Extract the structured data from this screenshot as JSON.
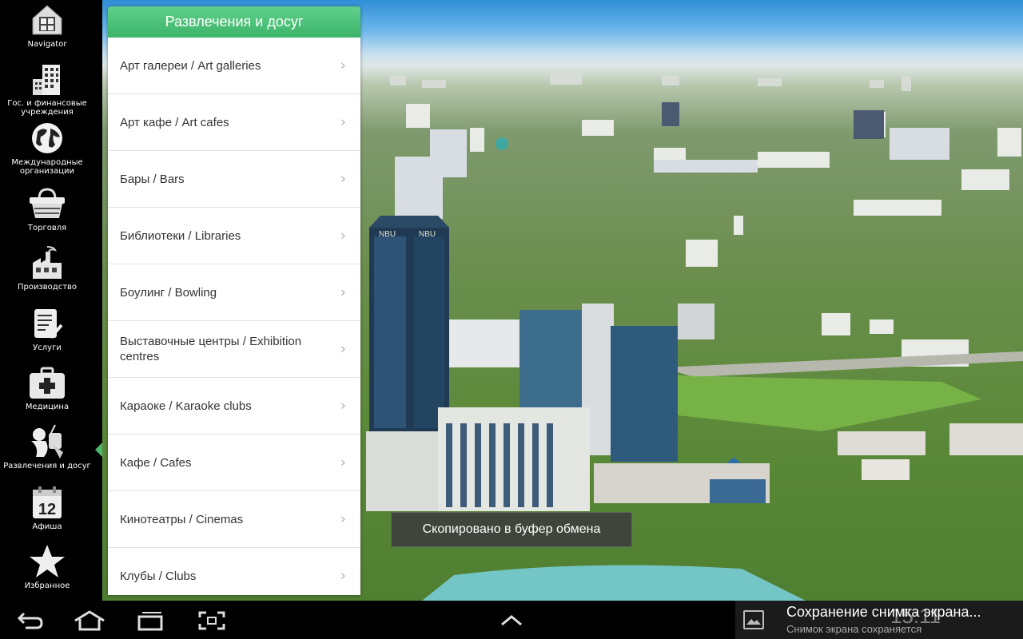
{
  "sidebar": {
    "items": [
      {
        "label": "Navigator",
        "icon": "home-grid-icon"
      },
      {
        "label": "Гос. и финансовые учреждения",
        "icon": "office-building-icon"
      },
      {
        "label": "Международные организации",
        "icon": "globe-icon"
      },
      {
        "label": "Торговля",
        "icon": "shopping-basket-icon"
      },
      {
        "label": "Производство",
        "icon": "factory-icon"
      },
      {
        "label": "Услуги",
        "icon": "checklist-icon"
      },
      {
        "label": "Медицина",
        "icon": "medical-kit-icon"
      },
      {
        "label": "Развлечения и досуг",
        "icon": "entertainment-icon"
      },
      {
        "label": "Афиша",
        "icon": "calendar-icon",
        "calendar_day": "12"
      },
      {
        "label": "Избранное",
        "icon": "star-icon"
      }
    ],
    "active_index": 7
  },
  "panel": {
    "title": "Развлечения и досуг",
    "items": [
      {
        "label": "Арт галереи / Art galleries"
      },
      {
        "label": "Арт кафе / Art cafes"
      },
      {
        "label": "Бары / Bars"
      },
      {
        "label": "Библиотеки / Libraries"
      },
      {
        "label": "Боулинг / Bowling"
      },
      {
        "label": "Выставочные центры / Exhibition centres"
      },
      {
        "label": "Караоке / Karaoke clubs"
      },
      {
        "label": "Кафе / Cafes"
      },
      {
        "label": "Кинотеатры / Cinemas"
      },
      {
        "label": "Клубы / Clubs"
      }
    ],
    "chevron": "›"
  },
  "toast": {
    "text": "Скопировано в буфер обмена"
  },
  "background": {
    "building_sign": "NBU"
  },
  "system_bar": {
    "buttons": [
      "back-icon",
      "home-icon",
      "recent-apps-icon",
      "screenshot-icon",
      "chevron-up-icon"
    ],
    "notification_title": "Сохранение снимка экрана...",
    "notification_subtitle": "Снимок экрана сохраняется",
    "clock": "15:11"
  },
  "colors": {
    "accent_green": "#3db46a",
    "sidebar_bg": "#000000",
    "panel_bg": "#ffffff"
  }
}
